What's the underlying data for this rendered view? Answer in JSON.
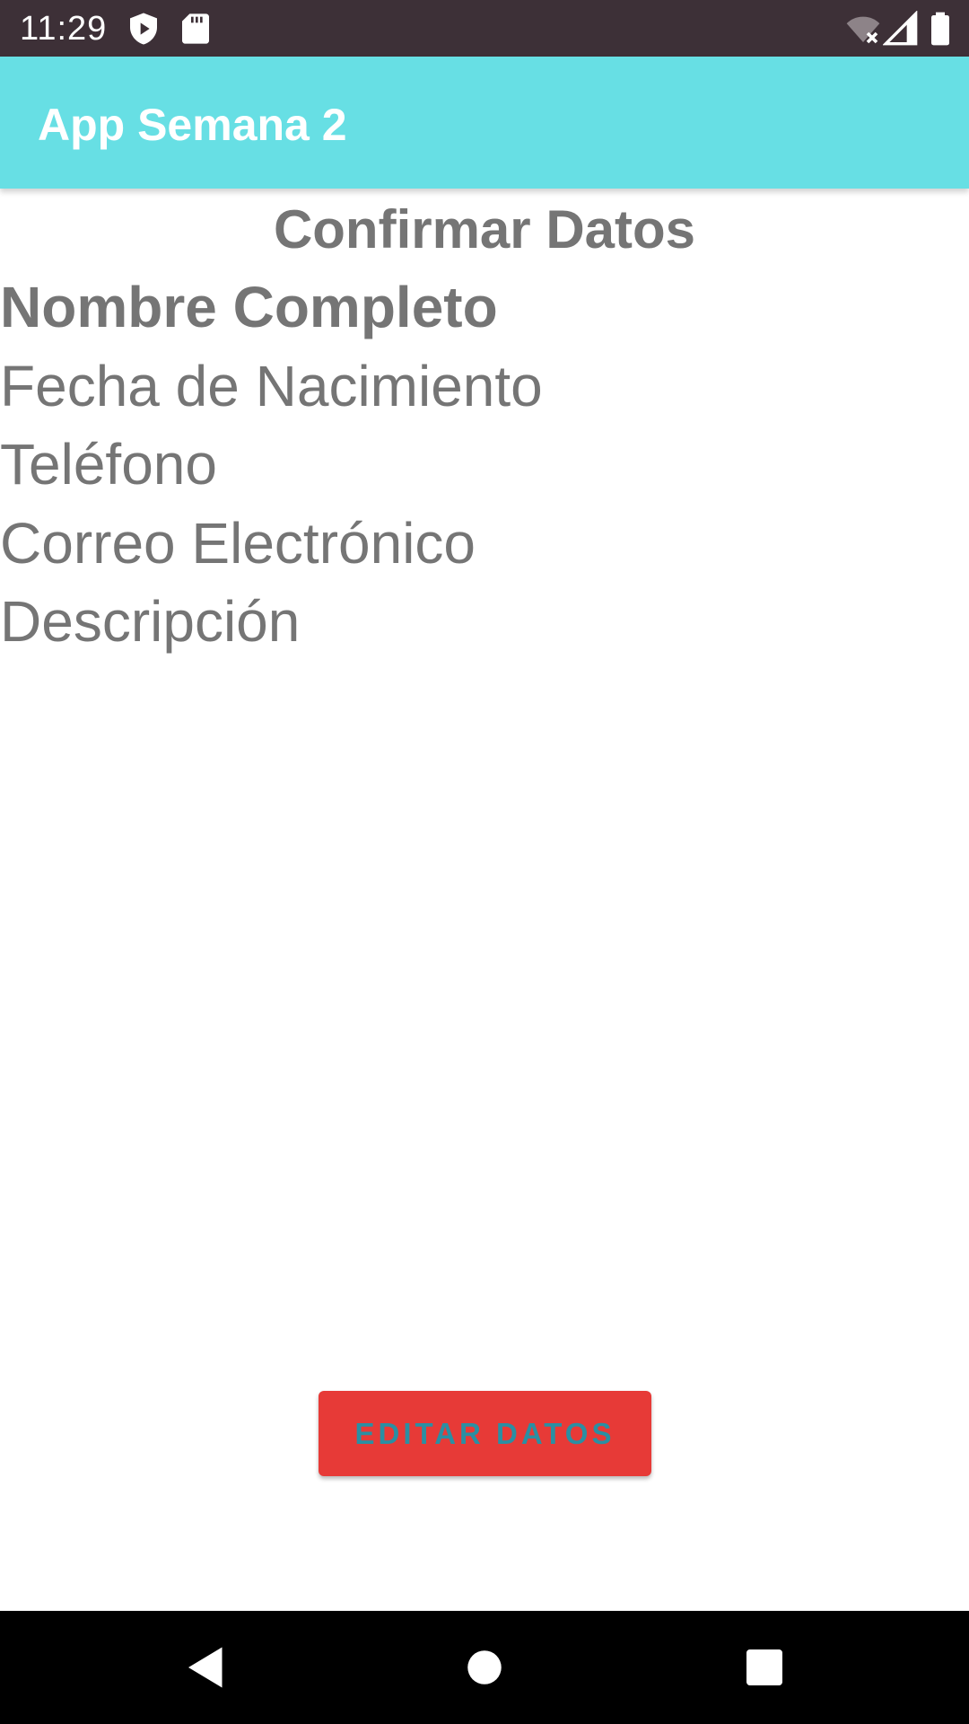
{
  "status_bar": {
    "time": "11:29",
    "icons": [
      "shield-play-icon",
      "sd-card-icon",
      "wifi-off-icon",
      "signal-icon",
      "battery-icon"
    ]
  },
  "app_bar": {
    "title": "App Semana 2",
    "background_color": "#67dfe4"
  },
  "content": {
    "title": "Confirmar Datos",
    "fields": {
      "nombre": "Nombre Completo",
      "fecha": "Fecha de Nacimiento",
      "telefono": "Teléfono",
      "correo": "Correo Electrónico",
      "descripcion": "Descripción"
    }
  },
  "button": {
    "label": "EDITAR DATOS",
    "background_color": "#e73a37",
    "text_color": "#2a8fa3"
  },
  "nav_bar": {
    "icons": [
      "back-icon",
      "home-icon",
      "recents-icon"
    ]
  }
}
